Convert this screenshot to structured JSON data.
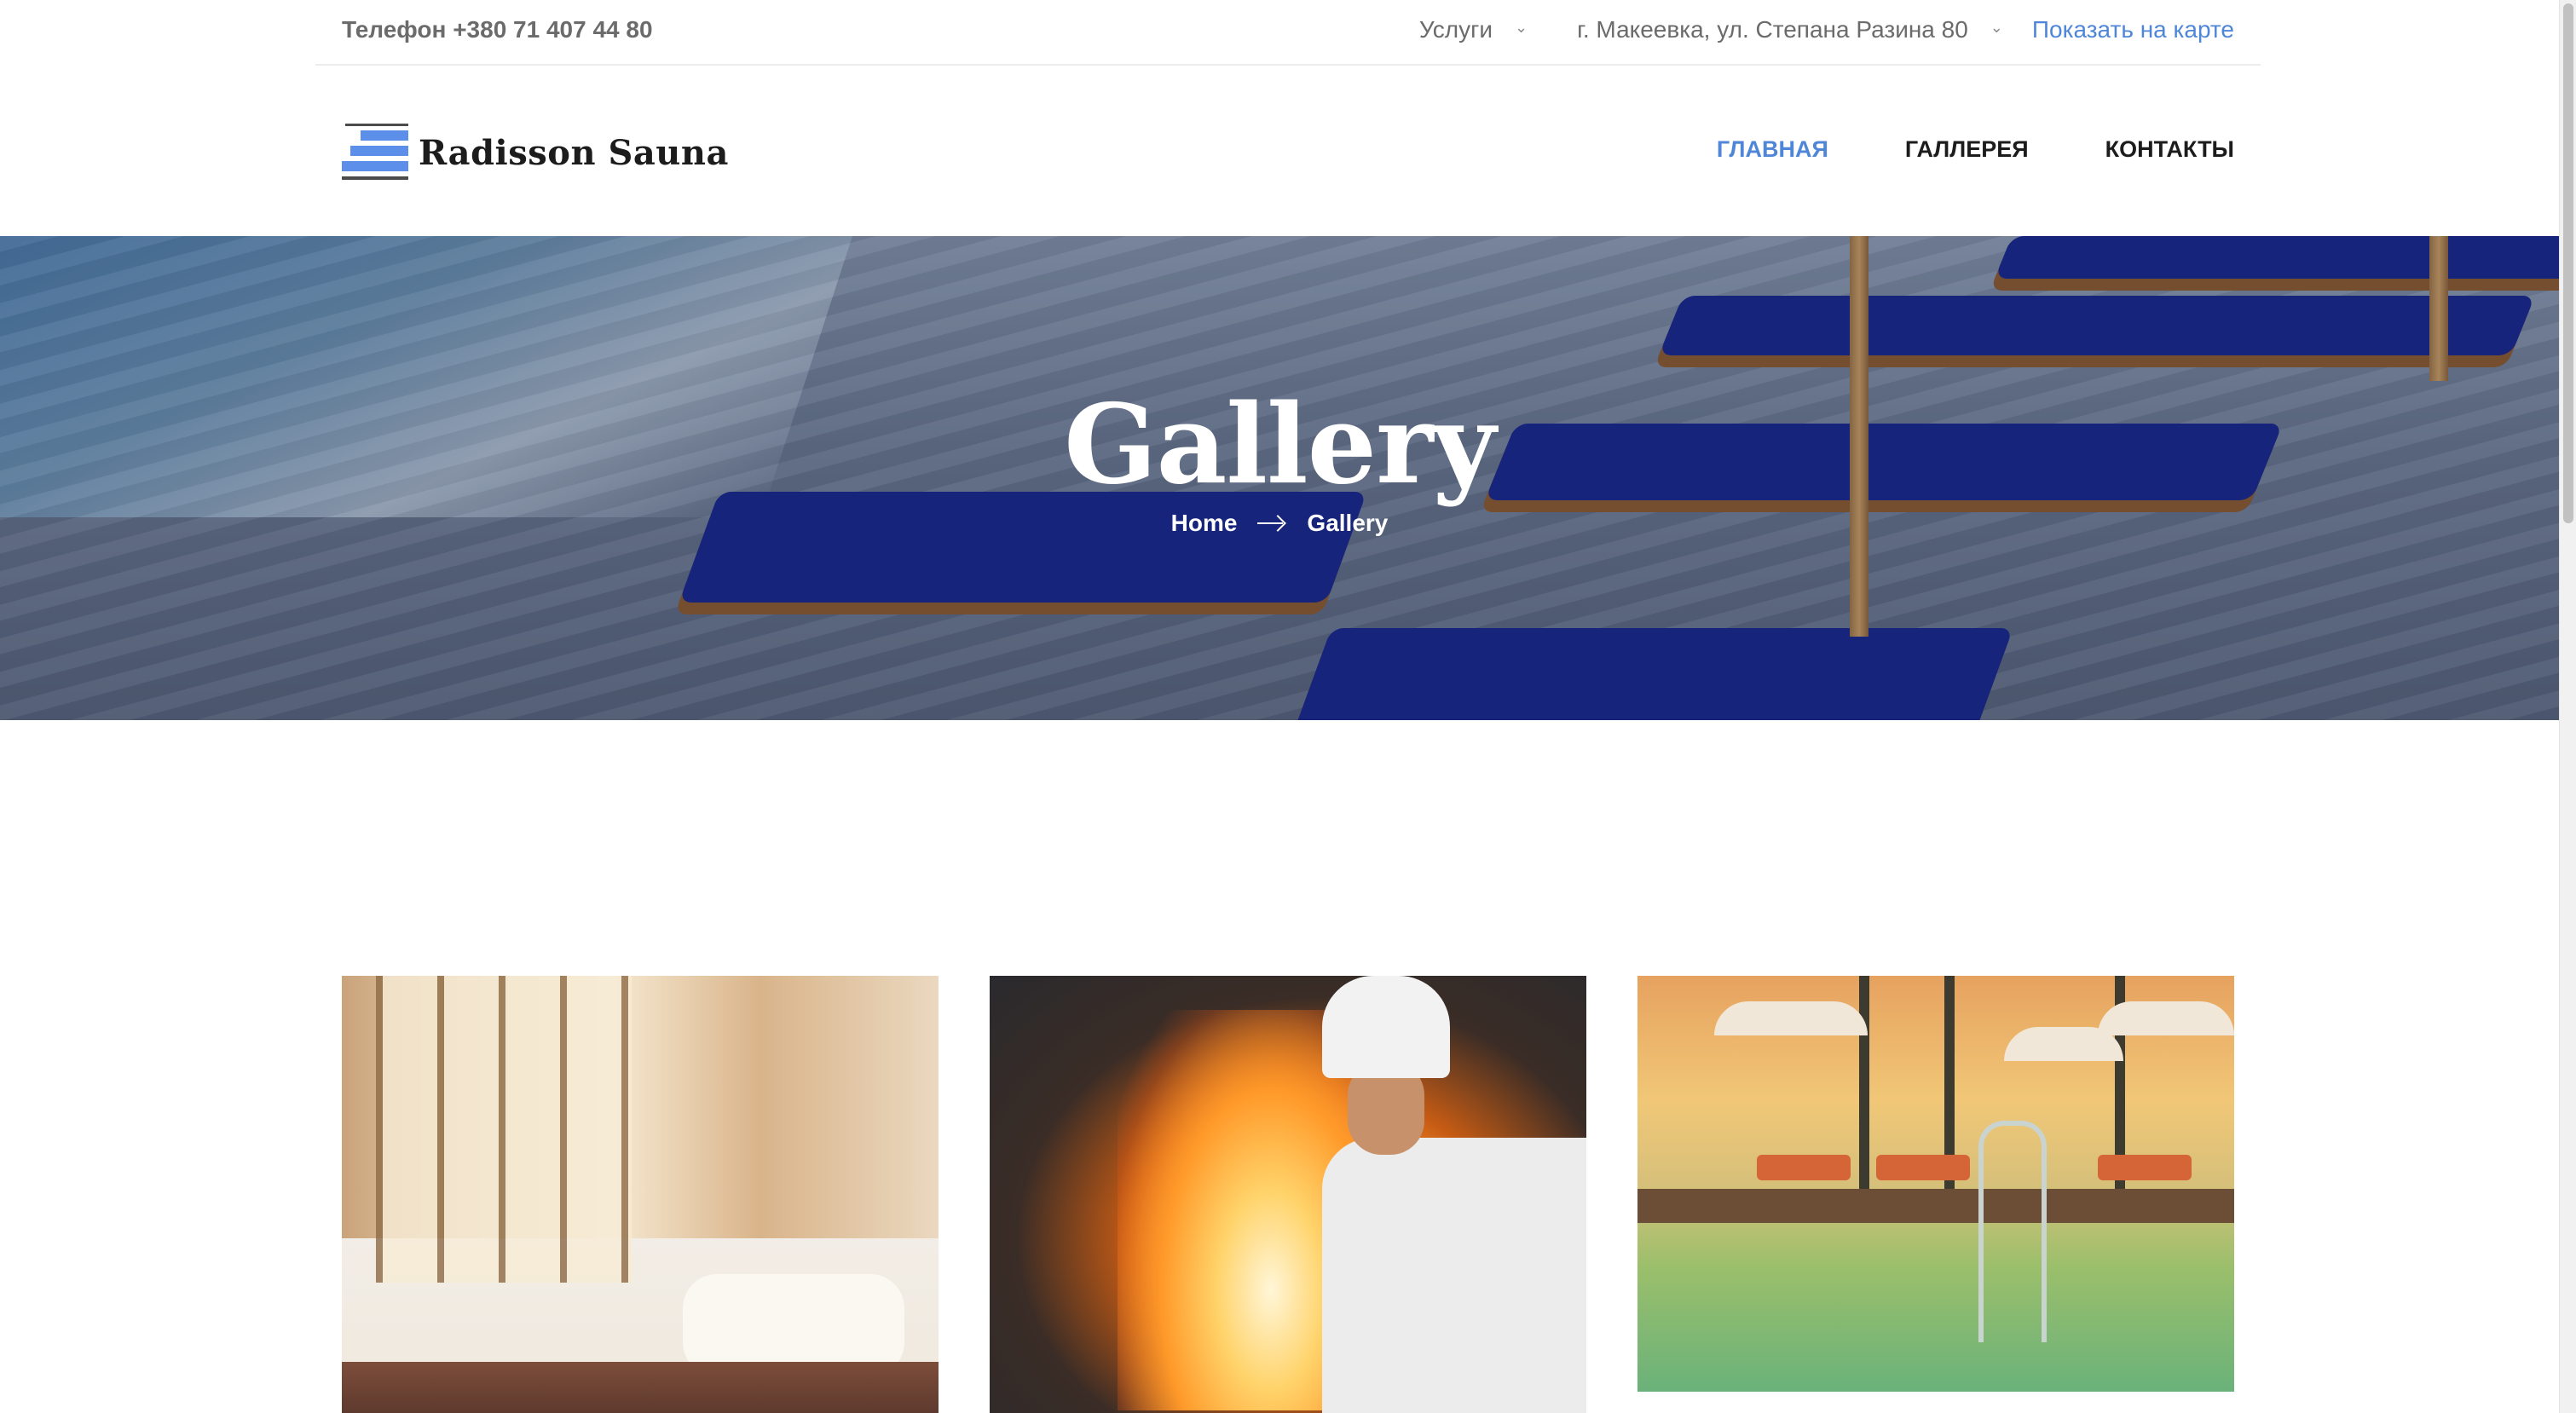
{
  "topbar": {
    "phone": "Телефон +380 71 407 44 80",
    "services_label": "Услуги",
    "address": "г. Макеевка, ул. Степана Разина 80",
    "map_link": "Показать на карте"
  },
  "header": {
    "logo_text": "Radisson Sauna",
    "nav": [
      {
        "label": "ГЛАВНАЯ",
        "active": true
      },
      {
        "label": "ГАЛЛЕРЕЯ",
        "active": false
      },
      {
        "label": "КОНТАКТЫ",
        "active": false
      }
    ]
  },
  "hero": {
    "title": "Gallery",
    "breadcrumb": {
      "home": "Home",
      "current": "Gallery"
    }
  },
  "gallery": {
    "images": [
      "hotel-bedroom-photo",
      "chef-flambe-photo",
      "poolside-resort-photo"
    ]
  },
  "colors": {
    "accent": "#4f86d8",
    "text_dark": "#1c1c1c",
    "text_muted": "#6b6b6b",
    "logo_blue": "#5b8fe9"
  },
  "icons": {
    "chevron": "chevron-down-icon",
    "breadcrumb_separator": "arrow-right-icon",
    "logo": "logo-stripes-icon"
  }
}
